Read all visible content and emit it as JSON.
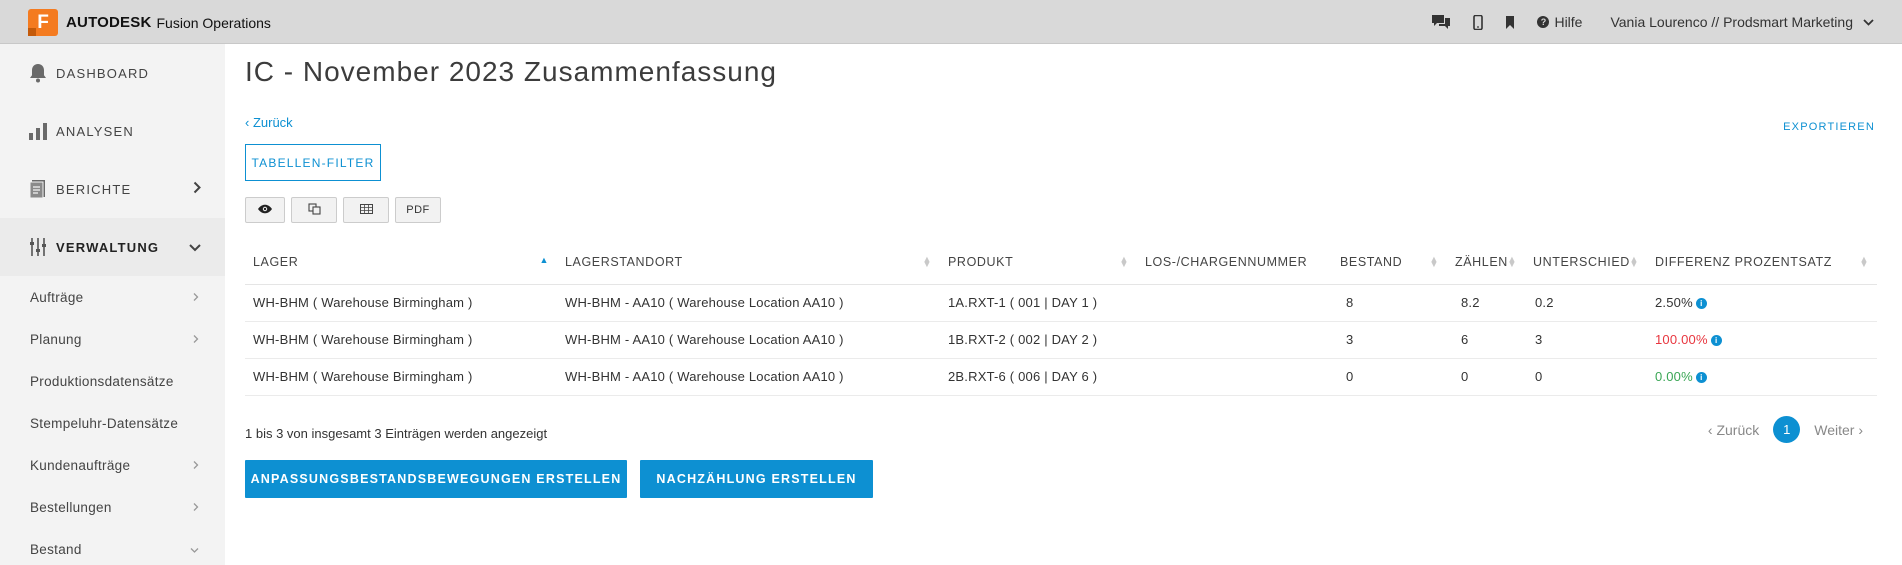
{
  "topbar": {
    "logo_letter": "F",
    "brand_bold": "AUTODESK",
    "brand_product": "Fusion Operations",
    "help_label": "Hilfe",
    "user_label": "Vania Lourenco // Prodsmart Marketing"
  },
  "sidebar": {
    "main_items": [
      {
        "label": "DASHBOARD",
        "icon": "bell-icon"
      },
      {
        "label": "ANALYSEN",
        "icon": "bar-chart-icon"
      },
      {
        "label": "BERICHTE",
        "icon": "report-icon"
      },
      {
        "label": "VERWALTUNG",
        "icon": "sliders-icon"
      }
    ],
    "sub_items": [
      {
        "label": "Aufträge"
      },
      {
        "label": "Planung"
      },
      {
        "label": "Produktionsdatensätze"
      },
      {
        "label": "Stempeluhr-Datensätze"
      },
      {
        "label": "Kundenaufträge"
      },
      {
        "label": "Bestellungen"
      },
      {
        "label": "Bestand"
      }
    ]
  },
  "main": {
    "title": "IC - November 2023 Zusammenfassung",
    "back_label": "Zurück",
    "export_label": "EXPORTIEREN",
    "filter_label": "TABELLEN-FILTER",
    "toolbar": {
      "pdf_label": "PDF"
    },
    "table": {
      "headers": [
        "LAGER",
        "LAGERSTANDORT",
        "PRODUKT",
        "LOS-/CHARGENNUMMER",
        "BESTAND",
        "ZÄHLEN",
        "UNTERSCHIED",
        "DIFFERENZ PROZENTSATZ"
      ],
      "rows": [
        [
          "WH-BHM ( Warehouse Birmingham )",
          "WH-BHM - AA10 ( Warehouse Location AA10 )",
          "1A.RXT-1 ( 001 | DAY 1 )",
          "",
          "8",
          "8.2",
          "0.2",
          "2.50%"
        ],
        [
          "WH-BHM ( Warehouse Birmingham )",
          "WH-BHM - AA10 ( Warehouse Location AA10 )",
          "1B.RXT-2 ( 002 | DAY 2 )",
          "",
          "3",
          "6",
          "3",
          "100.00%"
        ],
        [
          "WH-BHM ( Warehouse Birmingham )",
          "WH-BHM - AA10 ( Warehouse Location AA10 )",
          "2B.RXT-6 ( 006 | DAY 6 )",
          "",
          "0",
          "0",
          "0",
          "0.00%"
        ]
      ]
    },
    "entries_info": "1 bis 3 von insgesamt 3 Einträgen werden angezeigt",
    "pagination": {
      "prev_label": "Zurück",
      "current_page": "1",
      "next_label": "Weiter"
    },
    "actions": {
      "adjustment_label": "ANPASSUNGSBESTANDSBEWEGUNGEN ERSTELLEN",
      "recount_label": "NACHZÄHLUNG ERSTELLEN"
    }
  },
  "colors": {
    "accent": "#0d90d2",
    "negative": "#e8363f",
    "neutral_ok": "#3aa655",
    "brand": "#f47b20"
  }
}
